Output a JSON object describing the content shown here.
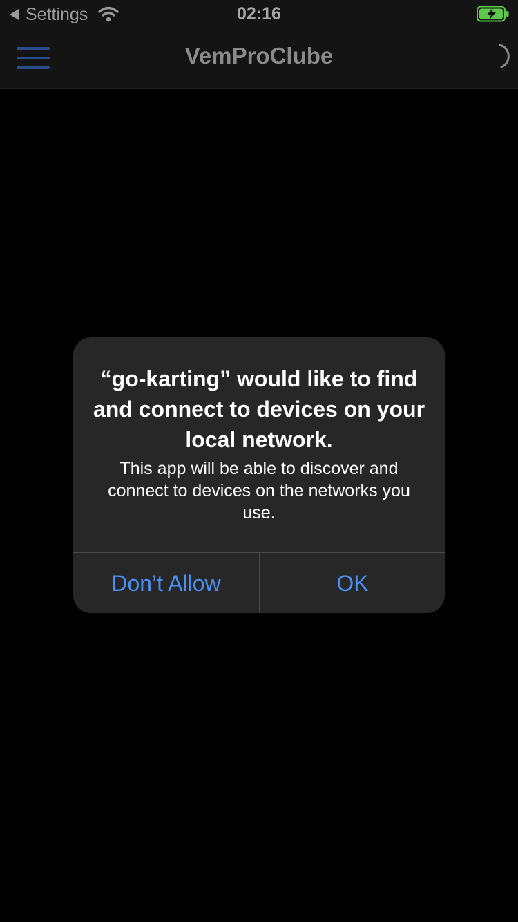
{
  "status_bar": {
    "back_app": "Settings",
    "time": "02:16",
    "wifi_icon": "wifi-icon",
    "battery_icon": "battery-charging-icon",
    "battery_color": "#5ec84a"
  },
  "nav": {
    "title": "VemProClube",
    "menu_icon": "hamburger-menu-icon",
    "loading_icon": "loading-spinner-icon",
    "menu_color": "#2a4d8a"
  },
  "alert": {
    "title": "“go-karting” would like to find and connect to devices on your local network.",
    "message": "This app will be able to discover and connect to devices on the networks you use.",
    "buttons": {
      "deny_label": "Don’t Allow",
      "ok_label": "OK"
    },
    "button_color": "#4a8ff2"
  }
}
